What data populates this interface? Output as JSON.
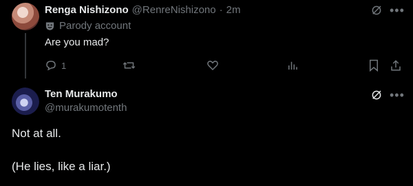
{
  "tweet1": {
    "display_name": "Renga Nishizono",
    "handle": "@RenreNishizono",
    "separator": "·",
    "time": "2m",
    "label": "Parody account",
    "text": "Are you mad?",
    "reply_count": "1"
  },
  "tweet2": {
    "display_name": "Ten Murakumo",
    "handle": "@murakumotenth",
    "text_line1": "Not at all.",
    "text_line2": "(He lies, like a liar.)"
  },
  "icons": {
    "grok": "grok-icon",
    "more": "more-icon",
    "parody": "mask-icon",
    "reply": "reply-icon",
    "retweet": "retweet-icon",
    "like": "heart-icon",
    "views": "views-icon",
    "bookmark": "bookmark-icon",
    "share": "share-icon"
  },
  "colors": {
    "background": "#000000",
    "text": "#e7e9ea",
    "muted": "#71767b"
  }
}
